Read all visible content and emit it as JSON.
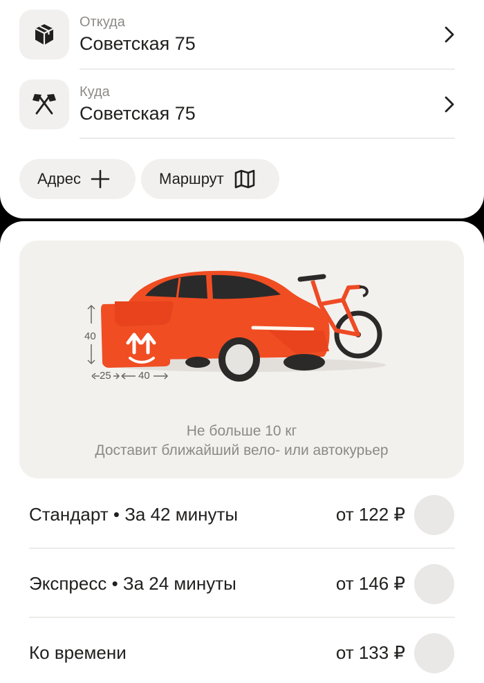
{
  "route": {
    "from": {
      "label": "Откуда",
      "value": "Советская 75",
      "icon": "box-icon"
    },
    "to": {
      "label": "Куда",
      "value": "Советская 75",
      "icon": "crossed-flags-icon"
    }
  },
  "chips": {
    "add_address": {
      "label": "Адрес",
      "icon": "plus-icon"
    },
    "route": {
      "label": "Маршрут",
      "icon": "map-icon"
    }
  },
  "promo": {
    "bag_height": "40",
    "bag_depth": "25",
    "bag_width": "40",
    "weight_limit": "Не больше 10 кг",
    "description": "Доставит ближайший вело- или автокурьер"
  },
  "tariffs": [
    {
      "name": "Стандарт • За 42 минуты",
      "price": "от 122 ₽",
      "selected": false
    },
    {
      "name": "Экспресс • За 24 минуты",
      "price": "от 146 ₽",
      "selected": false
    },
    {
      "name": "Ко времени",
      "price": "от 133 ₽",
      "selected": false
    }
  ],
  "colors": {
    "accent": "#fa4a1f",
    "chip_bg": "#f2f0ee",
    "promo_bg": "#f3f1ee",
    "secondary_text": "#8c8a87"
  }
}
